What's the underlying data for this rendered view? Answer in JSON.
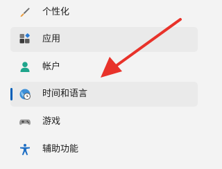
{
  "nav": {
    "items": [
      {
        "label": "个性化",
        "icon": "paintbrush-icon"
      },
      {
        "label": "应用",
        "icon": "apps-icon"
      },
      {
        "label": "帐户",
        "icon": "account-icon"
      },
      {
        "label": "时间和语言",
        "icon": "globe-clock-icon"
      },
      {
        "label": "游戏",
        "icon": "gamepad-icon"
      },
      {
        "label": "辅助功能",
        "icon": "accessibility-icon"
      }
    ],
    "selected_index": 3
  },
  "annotation": {
    "color": "#e8322a"
  }
}
